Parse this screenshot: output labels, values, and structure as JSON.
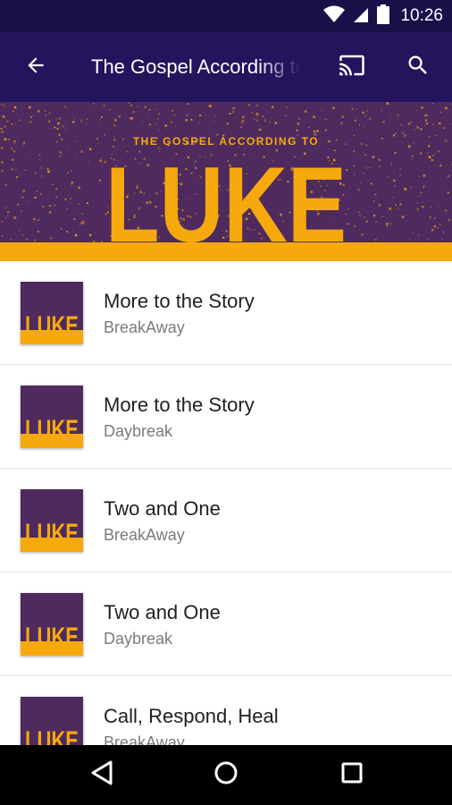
{
  "status_bar": {
    "time": "10:26"
  },
  "app_bar": {
    "title": "The Gospel According to Luke",
    "icons": [
      "arrow-back-icon",
      "cast-icon",
      "search-icon"
    ]
  },
  "hero": {
    "kicker": "THE GOSPEL ACCORDING TO",
    "title": "LUKE",
    "colors": {
      "purple": "#4f2a5e",
      "gold": "#f5a90d"
    }
  },
  "thumbnail_text": "LUKE",
  "episodes": [
    {
      "title": "More to the Story",
      "subtitle": "BreakAway"
    },
    {
      "title": "More to the Story",
      "subtitle": "Daybreak"
    },
    {
      "title": "Two and One",
      "subtitle": "BreakAway"
    },
    {
      "title": "Two and One",
      "subtitle": "Daybreak"
    },
    {
      "title": "Call, Respond, Heal",
      "subtitle": "BreakAway"
    }
  ],
  "colors": {
    "status_bar": "#1b0f4a",
    "app_bar": "#24145e",
    "title_text": "#1f1f1f",
    "subtitle_text": "#7b7b7b"
  }
}
